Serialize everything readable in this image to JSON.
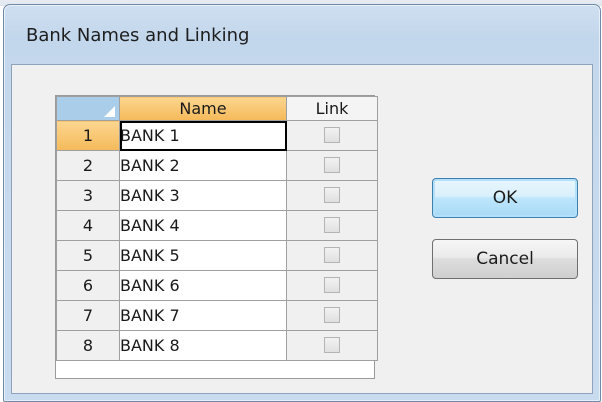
{
  "dialog": {
    "title": "Bank Names and Linking"
  },
  "grid": {
    "headers": {
      "name": "Name",
      "link": "Link"
    },
    "rows": [
      {
        "num": "1",
        "name": "BANK 1",
        "linked": false
      },
      {
        "num": "2",
        "name": "BANK 2",
        "linked": false
      },
      {
        "num": "3",
        "name": "BANK 3",
        "linked": false
      },
      {
        "num": "4",
        "name": "BANK 4",
        "linked": false
      },
      {
        "num": "5",
        "name": "BANK 5",
        "linked": false
      },
      {
        "num": "6",
        "name": "BANK 6",
        "linked": false
      },
      {
        "num": "7",
        "name": "BANK 7",
        "linked": false
      },
      {
        "num": "8",
        "name": "BANK 8",
        "linked": false
      }
    ],
    "selected_row": 0
  },
  "buttons": {
    "ok": "OK",
    "cancel": "Cancel"
  },
  "colors": {
    "selection_accent": "#f5b95a",
    "corner_header": "#aacde9",
    "dialog_frame": "#c9dbee"
  }
}
